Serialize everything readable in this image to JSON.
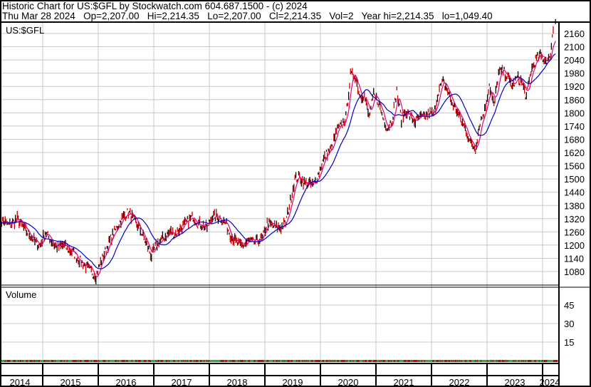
{
  "header": {
    "title": "Historic Chart for US:$GFL by Stockwatch.com 604.687.1500 - (c) 2024",
    "quote": "Thu Mar 28 2024   Op=2,207.00   Hi=2,214.35   Lo=2,207.00   Cl=2,214.35   Vol=2   Year hi=2,214.35   lo=1,049.40"
  },
  "chart_data": {
    "type": "line",
    "symbol": "US:$GFL",
    "volume_label": "Volume",
    "price_ticks": [
      1080,
      1140,
      1200,
      1260,
      1320,
      1380,
      1440,
      1500,
      1560,
      1620,
      1680,
      1740,
      1800,
      1860,
      1920,
      1980,
      2040,
      2100,
      2160
    ],
    "price_ylim": [
      1049,
      2208
    ],
    "volume_ticks": [
      15,
      30,
      45
    ],
    "volume_ylim": [
      0,
      60
    ],
    "years": [
      "2014",
      "2015",
      "2016",
      "2017",
      "2018",
      "2019",
      "2020",
      "2021",
      "2022",
      "2023",
      "2024"
    ],
    "start_month": "2014-03",
    "monthly_close": [
      1300,
      1310,
      1290,
      1300,
      1320,
      1290,
      1260,
      1240,
      1210,
      1200,
      1260,
      1230,
      1200,
      1190,
      1200,
      1180,
      1170,
      1140,
      1120,
      1100,
      1080,
      1060,
      1120,
      1170,
      1220,
      1260,
      1300,
      1330,
      1350,
      1320,
      1290,
      1250,
      1200,
      1150,
      1200,
      1220,
      1240,
      1260,
      1250,
      1270,
      1290,
      1310,
      1330,
      1300,
      1290,
      1280,
      1330,
      1330,
      1320,
      1300,
      1250,
      1220,
      1200,
      1200,
      1220,
      1210,
      1220,
      1230,
      1300,
      1290,
      1280,
      1280,
      1300,
      1400,
      1500,
      1510,
      1480,
      1480,
      1470,
      1520,
      1580,
      1620,
      1640,
      1720,
      1740,
      1780,
      1970,
      1970,
      1880,
      1880,
      1780,
      1880,
      1850,
      1780,
      1730,
      1770,
      1900,
      1770,
      1810,
      1780,
      1760,
      1780,
      1780,
      1800,
      1790,
      1900,
      1940,
      1900,
      1840,
      1810,
      1760,
      1720,
      1660,
      1640,
      1760,
      1810,
      1930,
      1830,
      1980,
      1990,
      1960,
      1920,
      1960,
      1940,
      1870,
      1990,
      2040,
      2060,
      2040,
      2040,
      2214
    ],
    "series": [
      {
        "name": "Price bars",
        "color": "#cc0000"
      },
      {
        "name": "Short moving average",
        "color": "#e0007a"
      },
      {
        "name": "Long moving average",
        "color": "#0000cc"
      }
    ]
  }
}
